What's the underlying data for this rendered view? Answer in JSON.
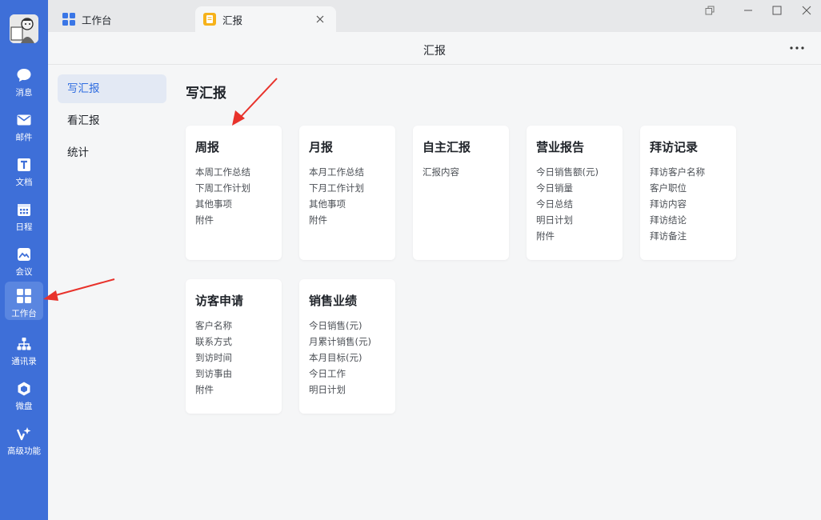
{
  "rail": {
    "items": [
      {
        "label": "消息",
        "icon": "chat-bubble-icon"
      },
      {
        "label": "邮件",
        "icon": "mail-icon"
      },
      {
        "label": "文档",
        "icon": "document-icon"
      },
      {
        "label": "日程",
        "icon": "calendar-icon"
      },
      {
        "label": "会议",
        "icon": "meeting-icon"
      },
      {
        "label": "工作台",
        "icon": "grid-icon",
        "active": true
      },
      {
        "label": "通讯录",
        "icon": "org-chart-icon"
      },
      {
        "label": "微盘",
        "icon": "cloud-drive-icon"
      },
      {
        "label": "高级功能",
        "icon": "sparkle-icon"
      }
    ]
  },
  "tabs": [
    {
      "label": "工作台",
      "icon": "grid-icon"
    },
    {
      "label": "汇报",
      "icon": "report-icon",
      "active": true
    }
  ],
  "header": {
    "title": "汇报"
  },
  "subnav": {
    "items": [
      {
        "label": "写汇报",
        "active": true
      },
      {
        "label": "看汇报"
      },
      {
        "label": "统计"
      }
    ]
  },
  "main": {
    "section_title": "写汇报",
    "cards": [
      {
        "title": "周报",
        "fields": [
          "本周工作总结",
          "下周工作计划",
          "其他事项",
          "附件"
        ]
      },
      {
        "title": "月报",
        "fields": [
          "本月工作总结",
          "下月工作计划",
          "其他事项",
          "附件"
        ]
      },
      {
        "title": "自主汇报",
        "fields": [
          "汇报内容"
        ]
      },
      {
        "title": "营业报告",
        "fields": [
          "今日销售额(元)",
          "今日销量",
          "今日总结",
          "明日计划",
          "附件"
        ]
      },
      {
        "title": "拜访记录",
        "fields": [
          "拜访客户名称",
          "客户职位",
          "拜访内容",
          "拜访结论",
          "拜访备注"
        ]
      },
      {
        "title": "访客申请",
        "fields": [
          "客户名称",
          "联系方式",
          "到访时间",
          "到访事由",
          "附件"
        ]
      },
      {
        "title": "销售业绩",
        "fields": [
          "今日销售(元)",
          "月累计销售(元)",
          "本月目标(元)",
          "今日工作",
          "明日计划"
        ]
      }
    ]
  },
  "colors": {
    "rail_bg": "#3e6fd8",
    "rail_active": "#5a86e0",
    "accent": "#2e6ce0",
    "annotation_arrow": "#e8322b",
    "tab_icon_blue": "#3a76e6",
    "tab_icon_orange": "#f6b21a"
  }
}
